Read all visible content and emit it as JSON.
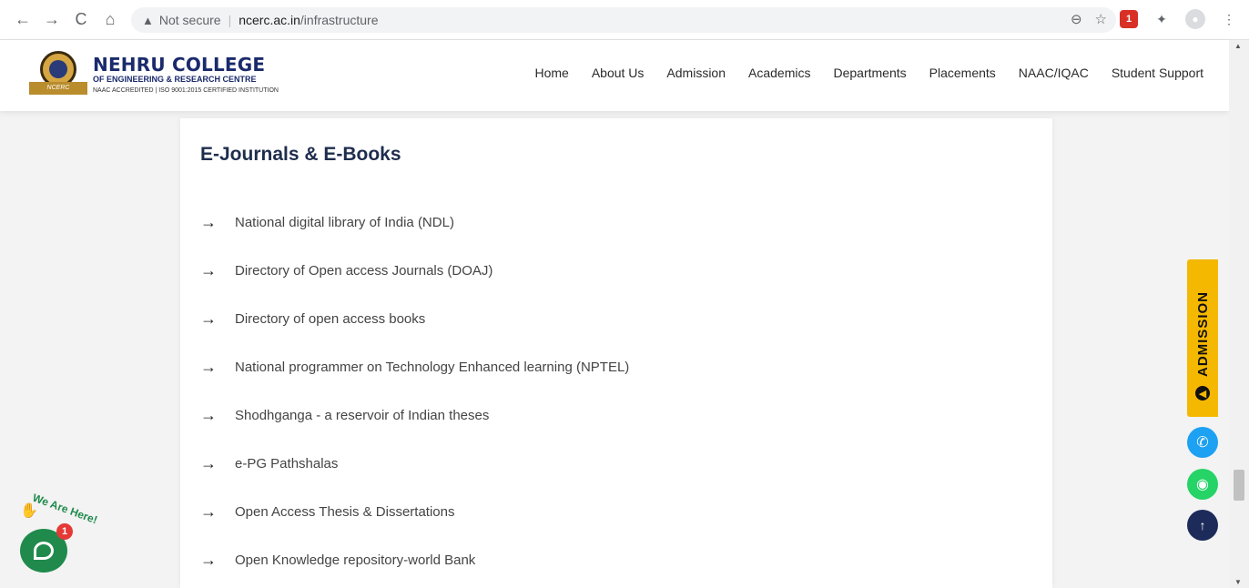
{
  "browser": {
    "back_icon": "←",
    "forward_icon": "→",
    "reload_icon": "C",
    "home_icon": "⌂",
    "security_label": "Not secure",
    "url_host": "ncerc.ac.in",
    "url_path": "/infrastructure",
    "zoom_icon": "⊖",
    "star_icon": "☆",
    "ext_badge": "1",
    "menu_icon": "⋮"
  },
  "site": {
    "logo_title": "NEHRU COLLEGE",
    "logo_sub": "OF ENGINEERING & RESEARCH CENTRE",
    "logo_cert": "NAAC ACCREDITED | ISO 9001:2015 CERTIFIED INSTITUTION",
    "logo_ribbon": "NCERC",
    "nav": [
      "Home",
      "About Us",
      "Admission",
      "Academics",
      "Departments",
      "Placements",
      "NAAC/IQAC",
      "Student Support"
    ]
  },
  "content": {
    "title": "E-Journals & E-Books",
    "links": [
      "National digital library of India (NDL)",
      "Directory of Open access Journals (DOAJ)",
      "Directory of open access books",
      "National programmer on Technology Enhanced learning (NPTEL)",
      "Shodhganga - a reservoir of Indian theses",
      "e-PG Pathshalas",
      "Open Access Thesis & Dissertations",
      "Open Knowledge repository-world Bank"
    ]
  },
  "widgets": {
    "admission_label": "ADMISSION",
    "chat_badge": "1",
    "chat_tagline": "We Are Here!"
  },
  "colors": {
    "accent_yellow": "#f5b800",
    "title_navy": "#1f2d4d",
    "whatsapp_green": "#25d366",
    "phone_blue": "#1da1f2",
    "totop_navy": "#1c2b5a"
  }
}
